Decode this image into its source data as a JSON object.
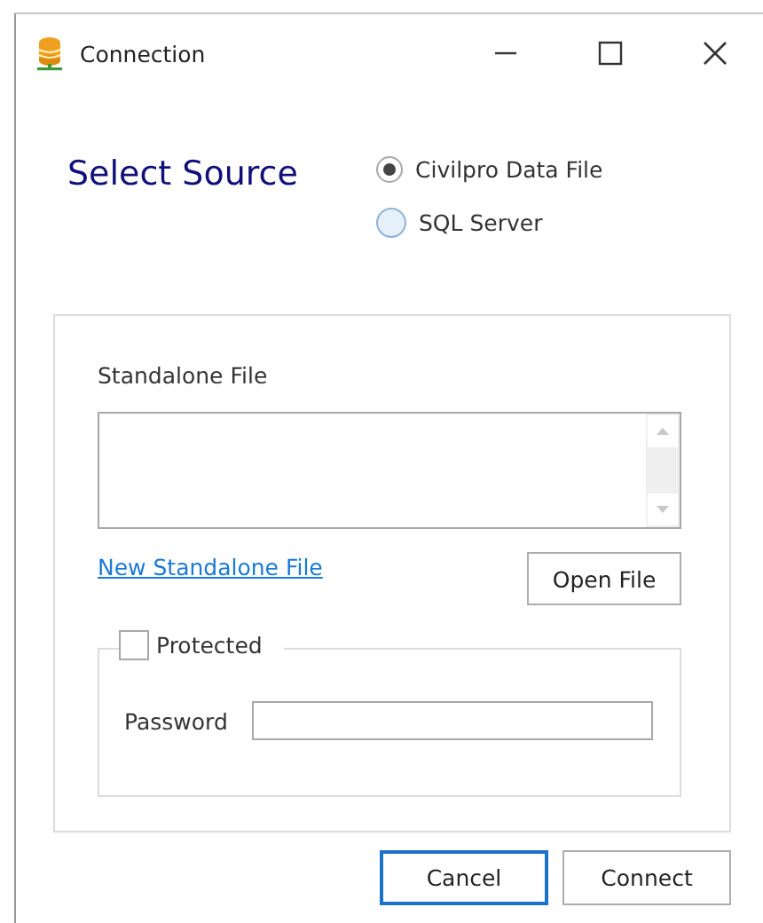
{
  "window": {
    "title": "Connection"
  },
  "heading": "Select Source",
  "sources": [
    {
      "label": "Civilpro Data File",
      "selected": true
    },
    {
      "label": "SQL Server",
      "selected": false
    }
  ],
  "standalone": {
    "label": "Standalone File",
    "link": "New Standalone File",
    "open_button": "Open File"
  },
  "protection": {
    "label": "Protected",
    "checked": false,
    "password_label": "Password"
  },
  "buttons": [
    {
      "label": "Cancel",
      "focused": true
    },
    {
      "label": "Connect",
      "focused": false
    }
  ]
}
